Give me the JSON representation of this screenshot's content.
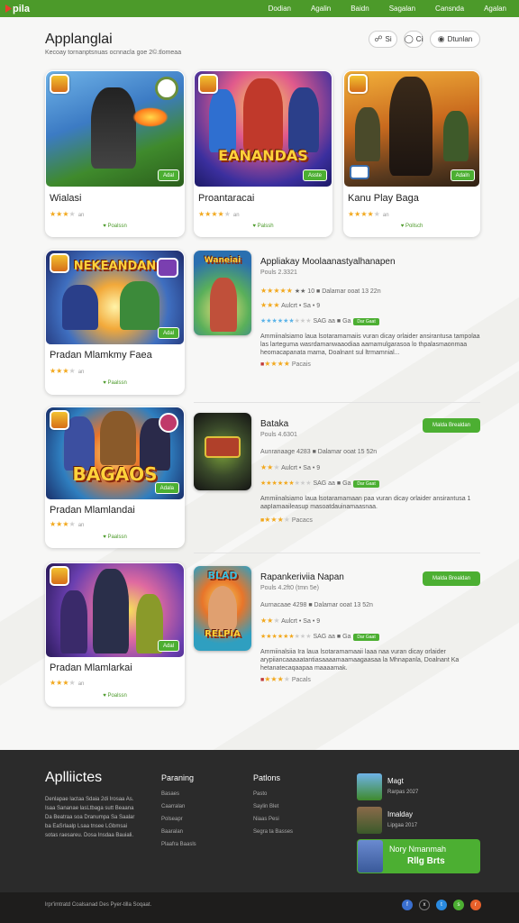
{
  "topbar": {
    "brand": "pila",
    "nav": [
      "Dodian",
      "Agalin",
      "Baidn",
      "Sagalan",
      "Cansnda",
      "Agalan"
    ]
  },
  "page": {
    "title": "Applanglai",
    "subtitle": "Kecoay tornanptsnuas ocnnacla goe 2©.tlomeaa",
    "pills": [
      {
        "icon": "share-icon",
        "label": "Si"
      },
      {
        "icon": "search-icon",
        "label": "Ci"
      },
      {
        "icon": "user-icon",
        "label": "Dtunlan"
      }
    ]
  },
  "top_cards": [
    {
      "name": "Wialasi",
      "stars": 3,
      "count": "an",
      "download": "Poalssn",
      "badge": "Adal",
      "art_title": ""
    },
    {
      "name": "Proantaracai",
      "stars": 4,
      "count": "an",
      "download": "Palssh",
      "badge": "Asste",
      "art_title": "EANANDAS"
    },
    {
      "name": "Kanu Play Baga",
      "stars": 4,
      "count": "an",
      "download": "Pollsch",
      "badge": "Adaln",
      "art_title": ""
    }
  ],
  "left_cards": [
    {
      "name": "Pradan Mlamkmy Faea",
      "stars": 3,
      "count": "an",
      "download": "Paalssn",
      "badge": "Adal",
      "art_title": "NEKEANDAN"
    },
    {
      "name": "Pradan Mlamlandai",
      "stars": 3,
      "count": "an",
      "download": "Paalssn",
      "badge": "Adala",
      "art_title": "BAGAOS"
    },
    {
      "name": "Pradan Mlamlarkai",
      "stars": 3,
      "count": "an",
      "download": "Poalssn",
      "badge": "Adal",
      "art_title": ""
    }
  ],
  "rows": [
    {
      "title": "Appliakay Moolaanastyalhanapen",
      "sub": "Pouls 2.3321",
      "line1": {
        "stars": 5,
        "text": "★★ 10 ■ Dalamar ooat 13 22n"
      },
      "line2": {
        "stars": 3,
        "text": "Aulcrt • Sa • 9"
      },
      "line3": {
        "stars": 6,
        "text": "SAG aa ■ Ga",
        "tag": "Dar Gaat"
      },
      "desc": "Ammiinalsiamo laua lsotaramamaiis vuran dicay orlaider ansirantusa tampolaa las larteguma wasrdamanwaaodiaa aamamulgarasoa lo thpalasmaonmaa heomacapanata mama, Doalnant sul ltrmamnial...",
      "icons": "Pacais",
      "button": ""
    },
    {
      "title": "Bataka",
      "sub": "Pouls 4.6301",
      "line1": {
        "stars": 0,
        "text": "Aunranaage 4283 ■ Dalamar ooat 15 52n"
      },
      "line2": {
        "stars": 2,
        "text": "Aulcrt • Sa • 9"
      },
      "line3": {
        "stars": 6,
        "text": "SAG aa ■ Ga",
        "tag": "Dar Gaat"
      },
      "desc": "Ammiinalsiamo laua lsotaramamaan paa vuran dicay orlaider ansirantusa 1 aapIamaaileasup masoatdauinamaasnaa.",
      "icons": "Pacacs",
      "button": "Malda Brealdan"
    },
    {
      "title": "Rapankeriviia Napan",
      "sub": "Pouls 4.2ft0 (tmn 5e)",
      "line1": {
        "stars": 0,
        "text": "Aurnacaae 4298 ■ Dalamar ooat 13 52n"
      },
      "line2": {
        "stars": 2,
        "text": "Aulcrt • Sa • 9"
      },
      "line3": {
        "stars": 6,
        "text": "SAG aa ■ Ga",
        "tag": "Dar Gaat"
      },
      "desc": "Ammiinalsiia Ira laua lsotaramamaaii laaa naa vuran dicay orlaider arypiiancaaaaatantiasaaaamaamaagaasaa la Mhnapanla, Doalnant Ka hetanatecaqaapaa maaaamak.",
      "icons": "Pacals",
      "button": "Malda Brealdan"
    }
  ],
  "footer": {
    "title": "Aplliictes",
    "desc": "Denlapae lactaa Sdaia 2di Irosaa As. Isaa Sananae lasLtbaga sutt Beaana Da Beatraa soa Dranumpa Sa Saalar ba EaSrlaalp Lsaa tnsee LGbmsai sotas raesareu. Dosa Insdaa Bauiali.",
    "columns": [
      {
        "heading": "Paraning",
        "links": [
          "Basaes",
          "Caarralan",
          "Polseapr",
          "Baaralan",
          "Plaafra Baasls"
        ]
      },
      {
        "heading": "Patlons",
        "links": [
          "Pasto",
          "Saylin Blet",
          "Niaas Pesi",
          "Segra ta Basses"
        ]
      }
    ],
    "featured": [
      {
        "title": "Magt",
        "sub": "Rarpas 2027"
      },
      {
        "title": "Imalday",
        "sub": "Lipgaa 2017"
      }
    ],
    "cta": {
      "line1": "Nory Nmanmah",
      "line2": "Rllg Brts"
    }
  },
  "bottom": {
    "copyright": "lrpr'imtratd Coalsanad Des Pyer-tilla Soqaat."
  },
  "colors": {
    "accent": "#4c9a2a",
    "footer_bg": "#2b2b2b",
    "star": "#f2a81d"
  }
}
